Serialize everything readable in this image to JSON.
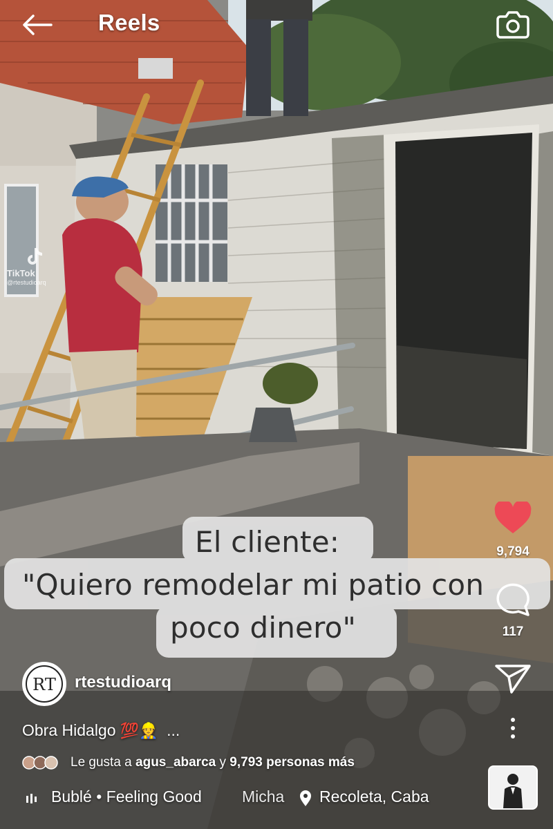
{
  "header": {
    "title": "Reels",
    "back_icon": "arrow-left-icon",
    "camera_icon": "camera-icon"
  },
  "video": {
    "watermark_brand": "TikTok",
    "watermark_user": "@rtestudioarq",
    "caption_overlay": [
      "El cliente:",
      "\"Quiero remodelar mi patio con",
      "poco dinero\""
    ]
  },
  "actions": {
    "likes_count": "9,794",
    "comments_count": "117",
    "heart_color": "#ed4956",
    "like_icon": "heart-icon",
    "comment_icon": "comment-icon",
    "share_icon": "send-icon",
    "more_icon": "more-vertical-icon"
  },
  "post": {
    "username": "rtestudioarq",
    "avatar_monogram": "RT",
    "caption_text": "Obra Hidalgo",
    "caption_emoji": "💯👷",
    "caption_more": "...",
    "likes_prefix": "Le gusta a",
    "liked_by_user": "agus_abarca",
    "likes_joiner": "y",
    "likes_others": "9,793 personas más",
    "audio_text": "Bublé • Feeling Good",
    "audio_overflow_text": "Micha",
    "location": "Recoleta, Caba"
  }
}
